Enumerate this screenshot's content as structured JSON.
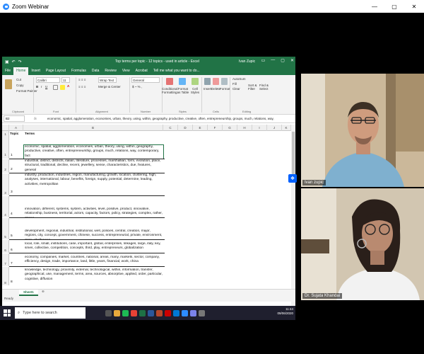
{
  "zoom": {
    "title": "Zoom Webinar",
    "controls": [
      "—",
      "▢",
      "✕"
    ]
  },
  "excel": {
    "title": "Top terms per topic - 12 topics - used in article - Excel",
    "user": "Ivan Zupic",
    "title_controls": [
      "▭",
      "—",
      "▢",
      "✕"
    ],
    "tabs": [
      "File",
      "Home",
      "Insert",
      "Page Layout",
      "Formulas",
      "Data",
      "Review",
      "View",
      "Acrobat",
      "Tell me what you want to do..."
    ],
    "active_tab": "Home",
    "ribbon": {
      "cut": "Cut",
      "copy": "Copy",
      "format_painter": "Format Painter",
      "clipboard_label": "Clipboard",
      "font_name": "Calibri",
      "font_size": "11",
      "font_label": "Font",
      "wrap_text": "Wrap Text",
      "merge_center": "Merge & Center",
      "alignment_label": "Alignment",
      "number_format": "General",
      "number_label": "Number",
      "conditional_formatting": "Conditional Formatting",
      "format_as_table": "Format as Table",
      "cell_styles": "Cell Styles",
      "styles_label": "Styles",
      "insert": "Insert",
      "delete": "Delete",
      "format": "Format",
      "cells_label": "Cells",
      "autosum": "AutoSum",
      "fill": "Fill",
      "clear": "Clear",
      "sort_filter": "Sort & Filter",
      "find_select": "Find & Select",
      "editing_label": "Editing"
    },
    "name_box": "B2",
    "fx": "fx",
    "formula": "economic, spatial, agglomeration, economies, urban, theory, using, within, geography, productive, creative, often, entrepreneurship, groups, much, relations, way,",
    "columns": [
      "A",
      "B",
      "C",
      "D",
      "E",
      "F",
      "G",
      "H",
      "I",
      "J",
      "K"
    ],
    "header": {
      "topic": "Topic",
      "terms": "Terms"
    },
    "rows": [
      {
        "num": "1",
        "topic": "1",
        "terms": "economic, spatial, agglomeration, economies, urban, theory, using, within, geography, productive, creative, often, entrepreneurship, groups, much, relations, way, contemporary, fact"
      },
      {
        "num": "2",
        "topic": "2",
        "terms": "industrial, district, districts, italian, literature, processes, marshallian, form, evolution, place, structural, traditional, decline, recent, jewellery, sense, characteristics, due, features, general"
      },
      {
        "num": "3",
        "topic": "3",
        "terms": "industry, production, industries, region, manufacturing, growth, location, clustering, high, analyses, international, labour, benefits, foreign, supply, potential, determine, leading, activities, metropolitan"
      },
      {
        "num": "4",
        "topic": "4",
        "terms": "innovation, different, systems, system, activities, level, positive, product, innovative, relationship, business, territorial, actors, capacity, factors, policy, strategies, complex, rather, strong"
      },
      {
        "num": "5",
        "topic": "5",
        "terms": "development, regional, industrial, institutional, well, policies, central, creation, major, regions, city, concept, government, chinese, success, entrepreneurial, private, environment, state, challenges"
      },
      {
        "num": "6",
        "topic": "6",
        "terms": "local, role, small, institutions, case, important, global, enterprises, linkages, large, italy, key, smes, collective, competition, concepts, third, play, entrepreneurs, globalization"
      },
      {
        "num": "7",
        "topic": "7",
        "terms": "economy, companies, market, countries, national, areas, many, markets, sector, company, efficiency, design, trade, importance, land, little, years, financial, work, china"
      },
      {
        "num": "8",
        "topic": "8",
        "terms": "knowledge, technology, proximity, external, technological, within, information, transfer, geographical, use, management, terms, area, sources, absorptive, applied, order, particular, cognitive, diffusion"
      }
    ],
    "sheet_tab": "Sheet1",
    "status": "Ready"
  },
  "taskbar": {
    "search_placeholder": "Type here to search",
    "time": "11:44",
    "date": "09/06/2020"
  },
  "participants": [
    {
      "name": "Ivan zupic"
    },
    {
      "name": "Dr. Sujata Khandai"
    }
  ],
  "colors": {
    "excel_green": "#217346",
    "zoom_blue": "#2d8cff",
    "taskbar": "#1f1f2e"
  }
}
